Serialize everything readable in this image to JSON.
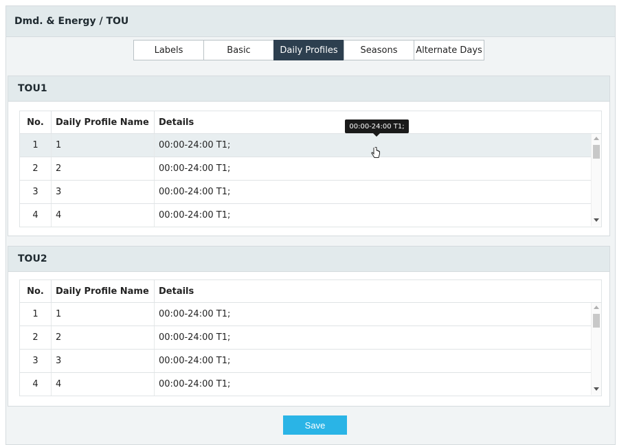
{
  "header": {
    "title": "Dmd. & Energy / TOU"
  },
  "tabs": [
    {
      "label": "Labels",
      "active": false
    },
    {
      "label": "Basic",
      "active": false
    },
    {
      "label": "Daily Profiles",
      "active": true
    },
    {
      "label": "Seasons",
      "active": false
    },
    {
      "label": "Alternate Days",
      "active": false
    }
  ],
  "columns": {
    "no": "No.",
    "name": "Daily Profile Name",
    "details": "Details"
  },
  "tou1": {
    "title": "TOU1",
    "rows": [
      {
        "no": "1",
        "name": "1",
        "details": "00:00-24:00 T1;"
      },
      {
        "no": "2",
        "name": "2",
        "details": "00:00-24:00 T1;"
      },
      {
        "no": "3",
        "name": "3",
        "details": "00:00-24:00 T1;"
      },
      {
        "no": "4",
        "name": "4",
        "details": "00:00-24:00 T1;"
      }
    ]
  },
  "tou2": {
    "title": "TOU2",
    "rows": [
      {
        "no": "1",
        "name": "1",
        "details": "00:00-24:00 T1;"
      },
      {
        "no": "2",
        "name": "2",
        "details": "00:00-24:00 T1;"
      },
      {
        "no": "3",
        "name": "3",
        "details": "00:00-24:00 T1;"
      },
      {
        "no": "4",
        "name": "4",
        "details": "00:00-24:00 T1;"
      }
    ]
  },
  "tooltip": {
    "text": "00:00-24:00 T1;"
  },
  "cursor": {
    "icon": "hand-pointer-icon"
  },
  "save_label": "Save",
  "colors": {
    "accent": "#2ab4e6",
    "active_tab": "#2d3f4f",
    "header_bg": "#e2eaec"
  }
}
